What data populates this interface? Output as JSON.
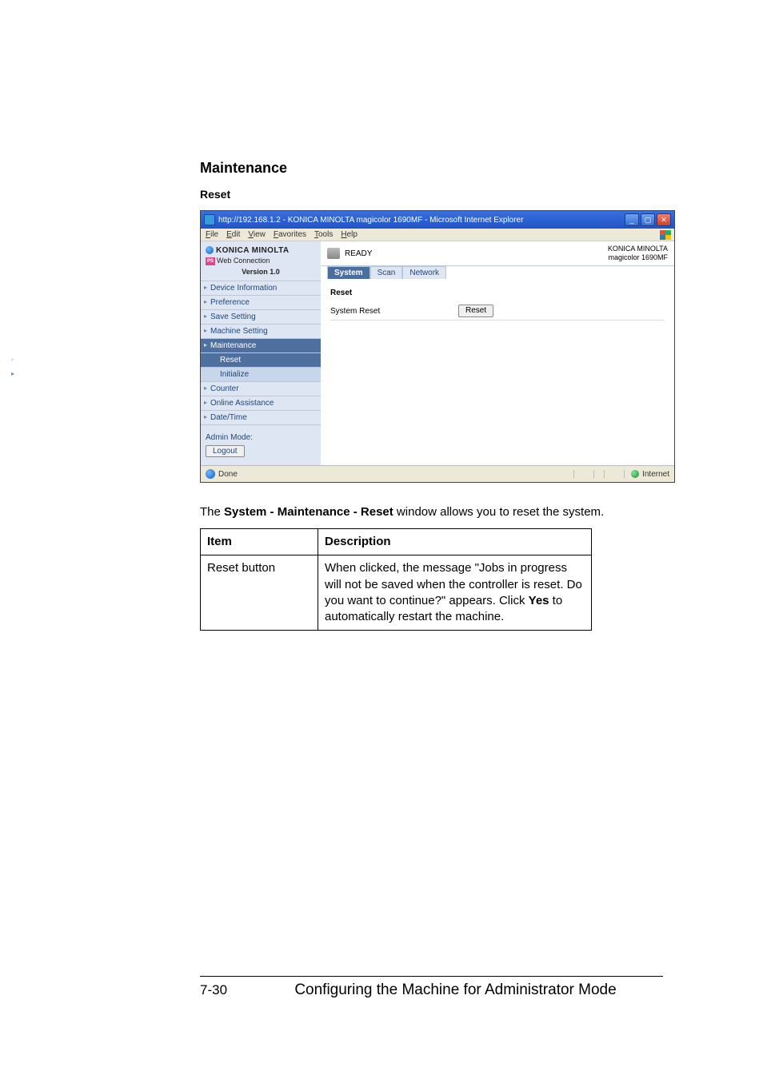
{
  "page": {
    "heading1": "Maintenance",
    "heading2": "Reset",
    "caption_prefix": "The ",
    "caption_bold": "System - Maintenance - Reset",
    "caption_suffix": " window allows you to reset the system.",
    "footer_page": "7-30",
    "footer_text": "Configuring the Machine for Administrator Mode"
  },
  "screenshot": {
    "titlebar": "http://192.168.1.2 - KONICA MINOLTA magicolor 1690MF - Microsoft Internet Explorer",
    "menubar": {
      "file": "File",
      "edit": "Edit",
      "view": "View",
      "favorites": "Favorites",
      "tools": "Tools",
      "help": "Help"
    },
    "brand": "KONICA MINOLTA",
    "brand_sub_top": "PAGE SCOPE",
    "brand_sub": "Web Connection",
    "version": "Version 1.0",
    "sidebar": {
      "items": [
        {
          "label": "Device Information"
        },
        {
          "label": "Preference"
        },
        {
          "label": "Save Setting"
        },
        {
          "label": "Machine Setting"
        },
        {
          "label": "Maintenance"
        },
        {
          "label": "Reset"
        },
        {
          "label": "Initialize"
        },
        {
          "label": "Counter"
        },
        {
          "label": "Online Assistance"
        },
        {
          "label": "Date/Time"
        }
      ],
      "admin_mode": "Admin Mode:",
      "logout": "Logout"
    },
    "status": "READY",
    "device_line1": "KONICA MINOLTA",
    "device_line2": "magicolor 1690MF",
    "tabs": {
      "system": "System",
      "scan": "Scan",
      "network": "Network"
    },
    "section_title": "Reset",
    "row_label": "System Reset",
    "reset_button": "Reset",
    "statusbar_done": "Done",
    "statusbar_internet": "Internet"
  },
  "table": {
    "h1": "Item",
    "h2": "Description",
    "r1c1": "Reset button",
    "r1c2_a": "When clicked, the message \"Jobs in progress will not be saved when the controller is reset. Do you want to continue?\" appears. Click ",
    "r1c2_bold": "Yes",
    "r1c2_b": " to automatically restart the machine."
  }
}
